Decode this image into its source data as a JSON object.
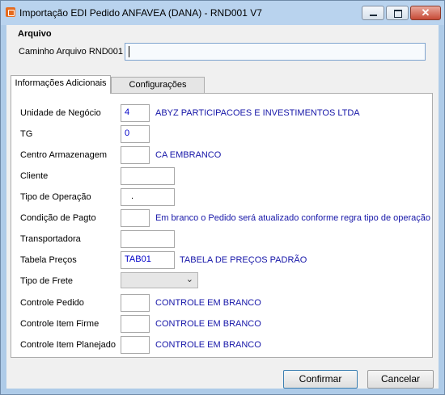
{
  "window": {
    "title": "Importação EDI Pedido ANFAVEA (DANA) - RND001 V7",
    "close_symbol": "✕"
  },
  "arquivo": {
    "section_title": "Arquivo",
    "path_label": "Caminho Arquivo RND001",
    "path_value": ""
  },
  "tabs": [
    {
      "label": "Informações Adicionais",
      "active": true
    },
    {
      "label": "Configurações",
      "active": false
    }
  ],
  "form": {
    "unidade": {
      "label": "Unidade de Negócio",
      "value": "4",
      "desc": "ABYZ PARTICIPACOES E INVESTIMENTOS LTDA"
    },
    "tg": {
      "label": "TG",
      "value": "0"
    },
    "centro": {
      "label": "Centro Armazenagem",
      "value": "",
      "desc": "CA EMBRANCO"
    },
    "cliente": {
      "label": "Cliente",
      "value": ""
    },
    "tipo_operacao": {
      "label": "Tipo de Operação",
      "value": "."
    },
    "condicao": {
      "label": "Condição de Pagto",
      "value": "",
      "desc": "Em branco o Pedido será atualizado conforme regra tipo de operação"
    },
    "transportadora": {
      "label": "Transportadora",
      "value": ""
    },
    "tabela": {
      "label": "Tabela Preços",
      "value": "TAB01",
      "desc": "TABELA DE PREÇOS PADRÃO"
    },
    "frete": {
      "label": "Tipo de Frete",
      "value": ""
    },
    "controle_pedido": {
      "label": "Controle Pedido",
      "value": "",
      "desc": "CONTROLE EM BRANCO"
    },
    "controle_firme": {
      "label": "Controle Item Firme",
      "value": "",
      "desc": "CONTROLE EM BRANCO"
    },
    "controle_planejado": {
      "label": "Controle Item Planejado",
      "value": "",
      "desc": "CONTROLE EM BRANCO"
    }
  },
  "buttons": {
    "confirm": "Confirmar",
    "cancel": "Cancelar"
  },
  "colors": {
    "title_bar": "#b9d3ee",
    "description_text": "#1616a8",
    "value_text": "#0000c8"
  }
}
